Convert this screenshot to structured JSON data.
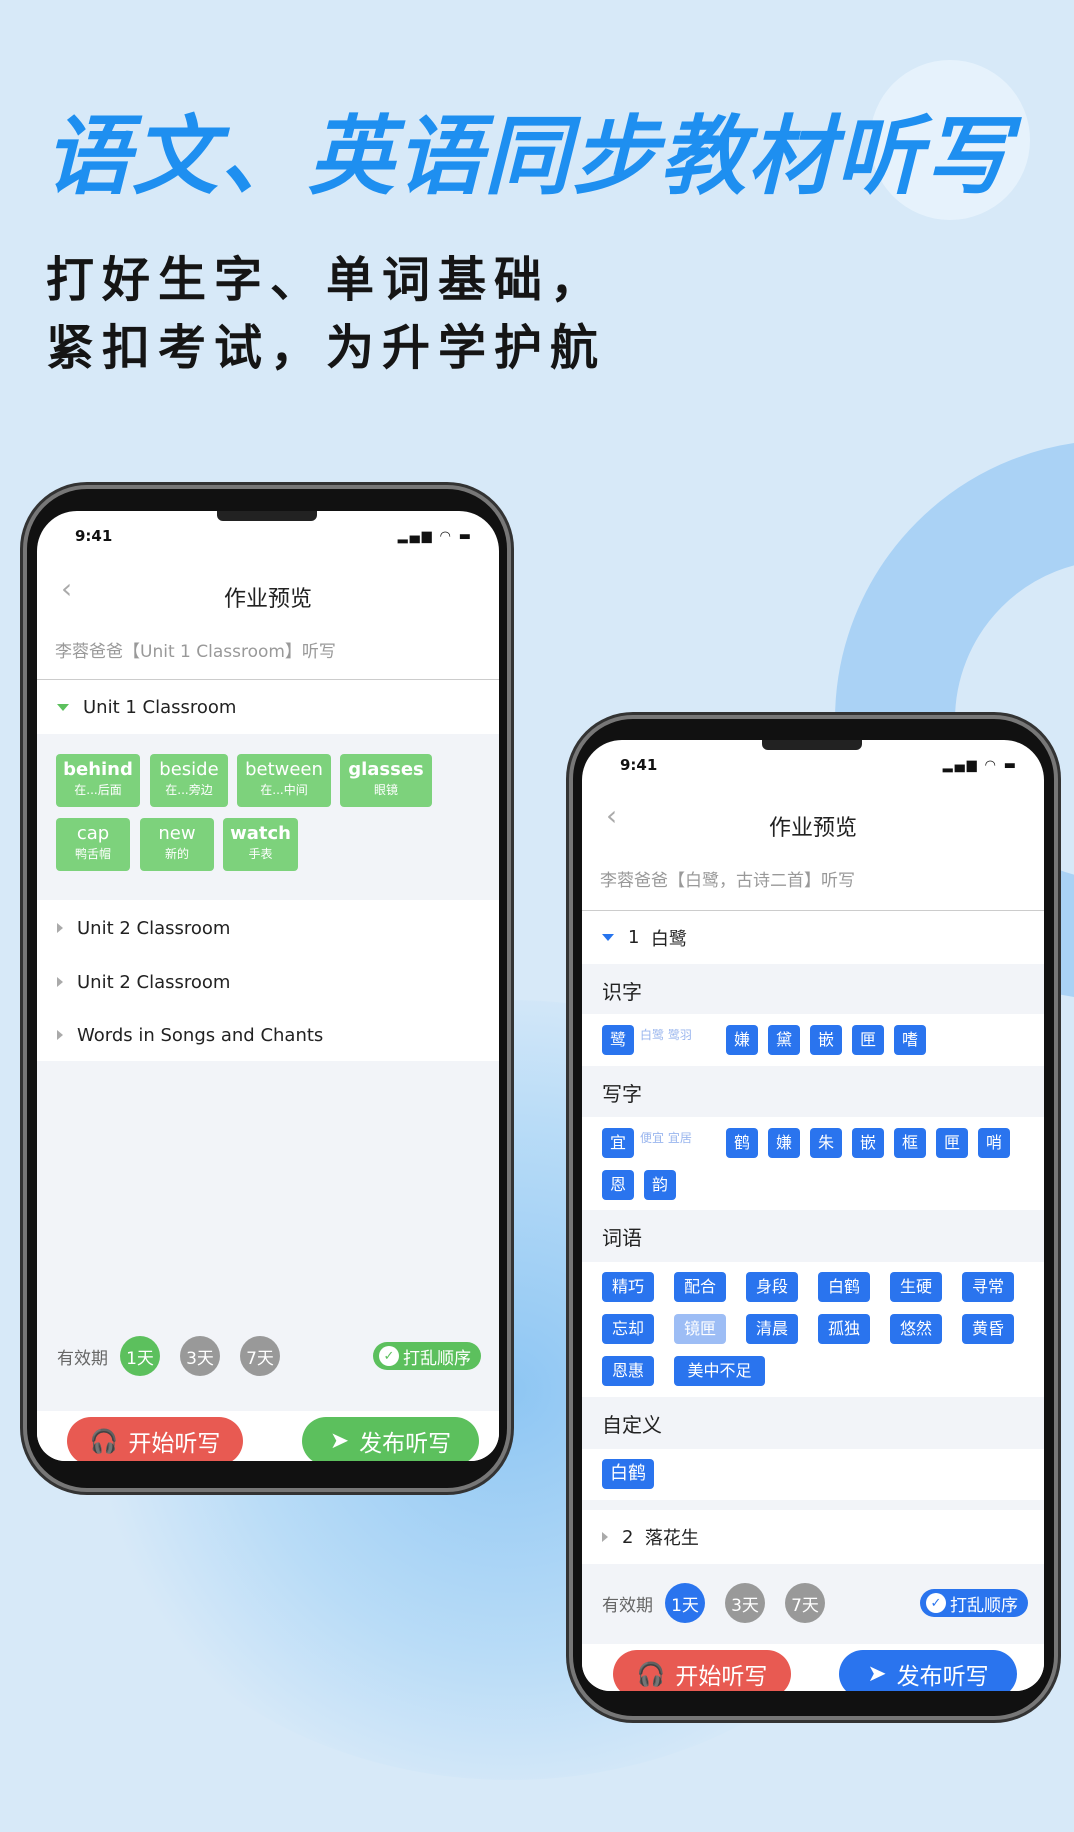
{
  "headline": "语文、英语同步教材听写",
  "subline1": "打好生字、单词基础，",
  "subline2": "紧扣考试，为升学护航",
  "colors": {
    "green": "#7dd27c",
    "blue": "#2a74ee",
    "red": "#e85a52",
    "headline": "#1e8ff0"
  },
  "phone1": {
    "time": "9:41",
    "status_icons": "signal wifi battery",
    "title": "作业预览",
    "subtitle": "李蓉爸爸【Unit 1 Classroom】听写",
    "units": [
      {
        "label": "Unit 1 Classroom",
        "expanded": true
      },
      {
        "label": "Unit 2 Classroom"
      },
      {
        "label": "Unit 2 Classroom"
      },
      {
        "label": "Words in Songs and Chants"
      }
    ],
    "words": [
      {
        "word": "behind",
        "meaning": "在...后面"
      },
      {
        "word": "beside",
        "meaning": "在...旁边"
      },
      {
        "word": "between",
        "meaning": "在...中间"
      },
      {
        "word": "glasses",
        "meaning": "眼镜"
      },
      {
        "word": "cap",
        "meaning": "鸭舌帽"
      },
      {
        "word": "new",
        "meaning": "新的"
      },
      {
        "word": "watch",
        "meaning": "手表"
      }
    ],
    "validity_label": "有效期",
    "days": [
      "1天",
      "3天",
      "7天"
    ],
    "selected_day": "1天",
    "shuffle": "打乱顺序",
    "start": "开始听写",
    "publish": "发布听写"
  },
  "phone2": {
    "time": "9:41",
    "title": "作业预览",
    "subtitle": "李蓉爸爸【白鹭，古诗二首】听写",
    "lesson1": {
      "num": "1",
      "name": "白鹭"
    },
    "recognize": {
      "title": "识字",
      "first": "鹭",
      "hints": "白鹭 鹭羽",
      "chars": [
        "嫌",
        "黛",
        "嵌",
        "匣",
        "嗜"
      ]
    },
    "write": {
      "title": "写字",
      "first": "宜",
      "hints": "便宜 宜居",
      "chars": [
        "鹤",
        "嫌",
        "朱",
        "嵌",
        "框",
        "匣",
        "哨",
        "恩",
        "韵"
      ]
    },
    "phrases": {
      "title": "词语",
      "items": [
        "精巧",
        "配合",
        "身段",
        "白鹤",
        "生硬",
        "寻常",
        "忘却",
        "镜匣",
        "清晨",
        "孤独",
        "悠然",
        "黄昏",
        "恩惠",
        "美中不足"
      ]
    },
    "custom": {
      "title": "自定义",
      "items": [
        "白鹤"
      ]
    },
    "lesson2": {
      "num": "2",
      "name": "落花生"
    },
    "validity_label": "有效期",
    "days": [
      "1天",
      "3天",
      "7天"
    ],
    "selected_day": "1天",
    "shuffle": "打乱顺序",
    "start": "开始听写",
    "publish": "发布听写"
  }
}
